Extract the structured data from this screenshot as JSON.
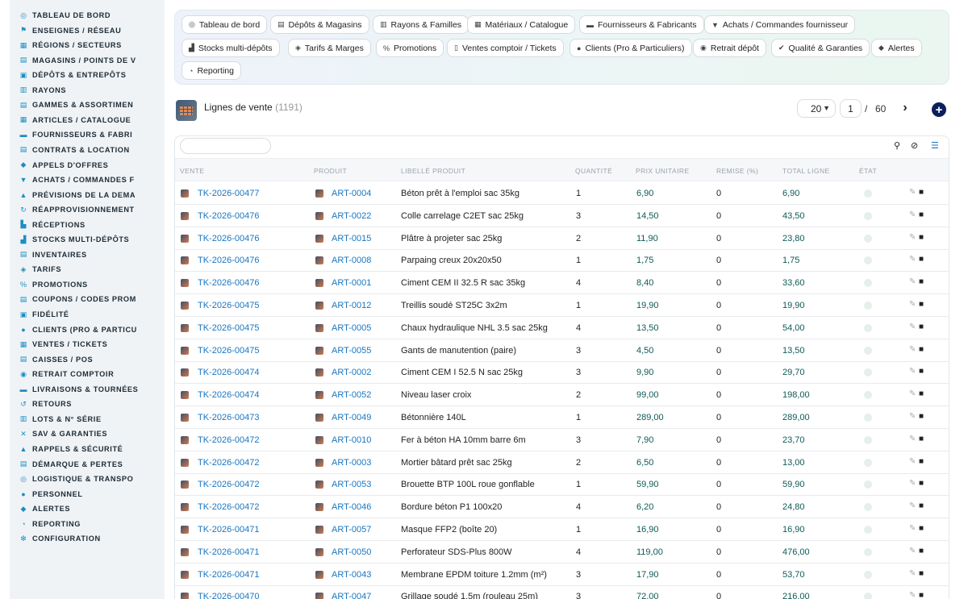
{
  "sidebar": {
    "items": [
      {
        "label": "TABLEAU DE BORD",
        "icon": "dashboard-icon",
        "glyph": "◎"
      },
      {
        "label": "ENSEIGNES / RÉSEAU",
        "icon": "flag-icon",
        "glyph": "⚑"
      },
      {
        "label": "RÉGIONS / SECTEURS",
        "icon": "map-icon",
        "glyph": "▦"
      },
      {
        "label": "MAGASINS / POINTS DE V",
        "icon": "store-icon",
        "glyph": "▤"
      },
      {
        "label": "DÉPÔTS & ENTREPÔTS",
        "icon": "warehouse-icon",
        "glyph": "▣"
      },
      {
        "label": "RAYONS",
        "icon": "shelf-icon",
        "glyph": "▥"
      },
      {
        "label": "GAMMES & ASSORTIMEN",
        "icon": "layers-icon",
        "glyph": "▤"
      },
      {
        "label": "ARTICLES / CATALOGUE",
        "icon": "book-icon",
        "glyph": "▦"
      },
      {
        "label": "FOURNISSEURS & FABRI",
        "icon": "truck-icon",
        "glyph": "▬"
      },
      {
        "label": "CONTRATS & LOCATION",
        "icon": "contract-icon",
        "glyph": "▤"
      },
      {
        "label": "APPELS D'OFFRES",
        "icon": "gavel-icon",
        "glyph": "◆"
      },
      {
        "label": "ACHATS / COMMANDES F",
        "icon": "cart-icon",
        "glyph": "▼"
      },
      {
        "label": "PRÉVISIONS DE LA DEMA",
        "icon": "chart-icon",
        "glyph": "▲"
      },
      {
        "label": "RÉAPPROVISIONNEMENT",
        "icon": "refresh-icon",
        "glyph": "↻"
      },
      {
        "label": "RÉCEPTIONS",
        "icon": "receipt-icon",
        "glyph": "▙"
      },
      {
        "label": "STOCKS MULTI-DÉPÔTS",
        "icon": "stock-icon",
        "glyph": "▟"
      },
      {
        "label": "INVENTAIRES",
        "icon": "inventory-icon",
        "glyph": "▤"
      },
      {
        "label": "TARIFS",
        "icon": "tag-icon",
        "glyph": "◈"
      },
      {
        "label": "PROMOTIONS",
        "icon": "percent-icon",
        "glyph": "%"
      },
      {
        "label": "COUPONS / CODES PROM",
        "icon": "coupon-icon",
        "glyph": "▤"
      },
      {
        "label": "FIDÉLITÉ",
        "icon": "loyalty-icon",
        "glyph": "▣"
      },
      {
        "label": "CLIENTS (PRO & PARTICU",
        "icon": "user-icon",
        "glyph": "●"
      },
      {
        "label": "VENTES / TICKETS",
        "icon": "ticket-icon",
        "glyph": "▦"
      },
      {
        "label": "CAISSES / POS",
        "icon": "register-icon",
        "glyph": "▤"
      },
      {
        "label": "RETRAIT COMPTOIR",
        "icon": "car-icon",
        "glyph": "◉"
      },
      {
        "label": "LIVRAISONS & TOURNÉES",
        "icon": "delivery-icon",
        "glyph": "▬"
      },
      {
        "label": "RETOURS",
        "icon": "undo-icon",
        "glyph": "↺"
      },
      {
        "label": "LOTS & N° SÉRIE",
        "icon": "barcode-icon",
        "glyph": "▥"
      },
      {
        "label": "SAV & GARANTIES",
        "icon": "tools-icon",
        "glyph": "✕"
      },
      {
        "label": "RAPPELS & SÉCURITÉ",
        "icon": "warning-icon",
        "glyph": "▲"
      },
      {
        "label": "DÉMARQUE & PERTES",
        "icon": "trash-icon",
        "glyph": "▤"
      },
      {
        "label": "LOGISTIQUE & TRANSPO",
        "icon": "route-icon",
        "glyph": "◎"
      },
      {
        "label": "PERSONNEL",
        "icon": "people-icon",
        "glyph": "●"
      },
      {
        "label": "ALERTES",
        "icon": "bell-icon",
        "glyph": "◆"
      },
      {
        "label": "REPORTING",
        "icon": "pie-chart-icon",
        "glyph": "◔"
      },
      {
        "label": "CONFIGURATION",
        "icon": "gear-icon",
        "glyph": "✻"
      }
    ]
  },
  "modules": [
    {
      "label": "Tableau de bord",
      "icon": "dashboard-icon",
      "glyph": "◎"
    },
    {
      "label": "Dépôts & Magasins",
      "icon": "store-icon",
      "glyph": "▤"
    },
    {
      "label": "Rayons & Familles",
      "icon": "shelf-icon",
      "glyph": "▥"
    },
    {
      "label": "Matériaux / Catalogue",
      "icon": "book-icon",
      "glyph": "▦"
    },
    {
      "label": "Fournisseurs & Fabricants",
      "icon": "truck-icon",
      "glyph": "▬"
    },
    {
      "label": "Achats / Commandes fournisseur",
      "icon": "cart-icon",
      "glyph": "▼"
    },
    {
      "label": "Stocks multi-dépôts",
      "icon": "stock-icon",
      "glyph": "▟"
    },
    {
      "label": "Tarifs & Marges",
      "icon": "tag-icon",
      "glyph": "◈"
    },
    {
      "label": "Promotions",
      "icon": "percent-icon",
      "glyph": "%"
    },
    {
      "label": "Ventes comptoir / Tickets",
      "icon": "ticket-icon",
      "glyph": "▯"
    },
    {
      "label": "Clients (Pro & Particuliers)",
      "icon": "user-icon",
      "glyph": "●"
    },
    {
      "label": "Retrait dépôt",
      "icon": "car-icon",
      "glyph": "◉"
    },
    {
      "label": "Qualité & Garanties",
      "icon": "check-icon",
      "glyph": "✔"
    },
    {
      "label": "Alertes",
      "icon": "bell-icon",
      "glyph": "◆"
    },
    {
      "label": "Reporting",
      "icon": "pie-chart-icon",
      "glyph": "◔"
    }
  ],
  "header": {
    "title": "Lignes de vente",
    "count": "(1191)",
    "per_page": "20",
    "page": "1",
    "page_sep": "/",
    "page_total": "60",
    "add_label": "+"
  },
  "table": {
    "search_placeholder": "",
    "columns": [
      "VENTE",
      "PRODUIT",
      "LIBELLÉ PRODUIT",
      "QUANTITÉ",
      "PRIX UNITAIRE",
      "REMISE (%)",
      "TOTAL LIGNE",
      "ÉTAT"
    ],
    "rows": [
      [
        "TK-2026-00477",
        "ART-0004",
        "Béton prêt à l'emploi sac 35kg",
        "1",
        "6,90",
        "0",
        "6,90"
      ],
      [
        "TK-2026-00476",
        "ART-0022",
        "Colle carrelage C2ET sac 25kg",
        "3",
        "14,50",
        "0",
        "43,50"
      ],
      [
        "TK-2026-00476",
        "ART-0015",
        "Plâtre à projeter sac 25kg",
        "2",
        "11,90",
        "0",
        "23,80"
      ],
      [
        "TK-2026-00476",
        "ART-0008",
        "Parpaing creux 20x20x50",
        "1",
        "1,75",
        "0",
        "1,75"
      ],
      [
        "TK-2026-00476",
        "ART-0001",
        "Ciment CEM II 32.5 R sac 35kg",
        "4",
        "8,40",
        "0",
        "33,60"
      ],
      [
        "TK-2026-00475",
        "ART-0012",
        "Treillis soudé ST25C 3x2m",
        "1",
        "19,90",
        "0",
        "19,90"
      ],
      [
        "TK-2026-00475",
        "ART-0005",
        "Chaux hydraulique NHL 3.5 sac 25kg",
        "4",
        "13,50",
        "0",
        "54,00"
      ],
      [
        "TK-2026-00475",
        "ART-0055",
        "Gants de manutention (paire)",
        "3",
        "4,50",
        "0",
        "13,50"
      ],
      [
        "TK-2026-00474",
        "ART-0002",
        "Ciment CEM I 52.5 N sac 25kg",
        "3",
        "9,90",
        "0",
        "29,70"
      ],
      [
        "TK-2026-00474",
        "ART-0052",
        "Niveau laser croix",
        "2",
        "99,00",
        "0",
        "198,00"
      ],
      [
        "TK-2026-00473",
        "ART-0049",
        "Bétonnière 140L",
        "1",
        "289,00",
        "0",
        "289,00"
      ],
      [
        "TK-2026-00472",
        "ART-0010",
        "Fer à béton HA 10mm barre 6m",
        "3",
        "7,90",
        "0",
        "23,70"
      ],
      [
        "TK-2026-00472",
        "ART-0003",
        "Mortier bâtard prêt sac 25kg",
        "2",
        "6,50",
        "0",
        "13,00"
      ],
      [
        "TK-2026-00472",
        "ART-0053",
        "Brouette BTP 100L roue gonflable",
        "1",
        "59,90",
        "0",
        "59,90"
      ],
      [
        "TK-2026-00472",
        "ART-0046",
        "Bordure béton P1 100x20",
        "4",
        "6,20",
        "0",
        "24,80"
      ],
      [
        "TK-2026-00471",
        "ART-0057",
        "Masque FFP2 (boîte 20)",
        "1",
        "16,90",
        "0",
        "16,90"
      ],
      [
        "TK-2026-00471",
        "ART-0050",
        "Perforateur SDS-Plus 800W",
        "4",
        "119,00",
        "0",
        "476,00"
      ],
      [
        "TK-2026-00471",
        "ART-0043",
        "Membrane EPDM toiture 1.2mm (m²)",
        "3",
        "17,90",
        "0",
        "53,70"
      ],
      [
        "TK-2026-00470",
        "ART-0047",
        "Grillage soudé 1.5m (rouleau 25m)",
        "3",
        "72,00",
        "0",
        "216,00"
      ]
    ]
  }
}
